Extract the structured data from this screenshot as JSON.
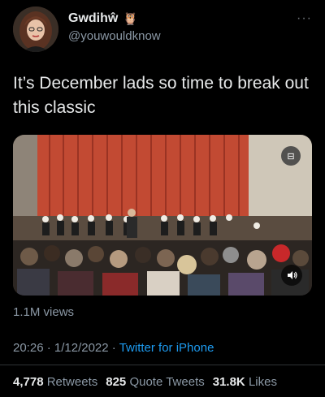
{
  "user": {
    "display_name": "Gwdihŵ",
    "badge_emoji": "🦉",
    "handle": "@youwouldknow",
    "avatar_icon": "profile-photo"
  },
  "menu": {
    "more_label": "···"
  },
  "tweet": {
    "text": "It’s December lads so time to break out this classic"
  },
  "media": {
    "type": "video",
    "gif_badge": "⊟",
    "sound_icon": "speaker-icon",
    "views": "1.1M views"
  },
  "meta": {
    "time": "20:26",
    "separator1": " · ",
    "date": "1/12/2022",
    "separator2": " · ",
    "source": "Twitter for iPhone"
  },
  "stats": {
    "retweets_count": "4,778",
    "retweets_label": "Retweets",
    "quotes_count": "825",
    "quotes_label": "Quote Tweets",
    "likes_count": "31.8K",
    "likes_label": "Likes"
  },
  "colors": {
    "background": "#000000",
    "text": "#e7e9ea",
    "secondary": "#8b98a5",
    "link": "#1d9bf0"
  }
}
